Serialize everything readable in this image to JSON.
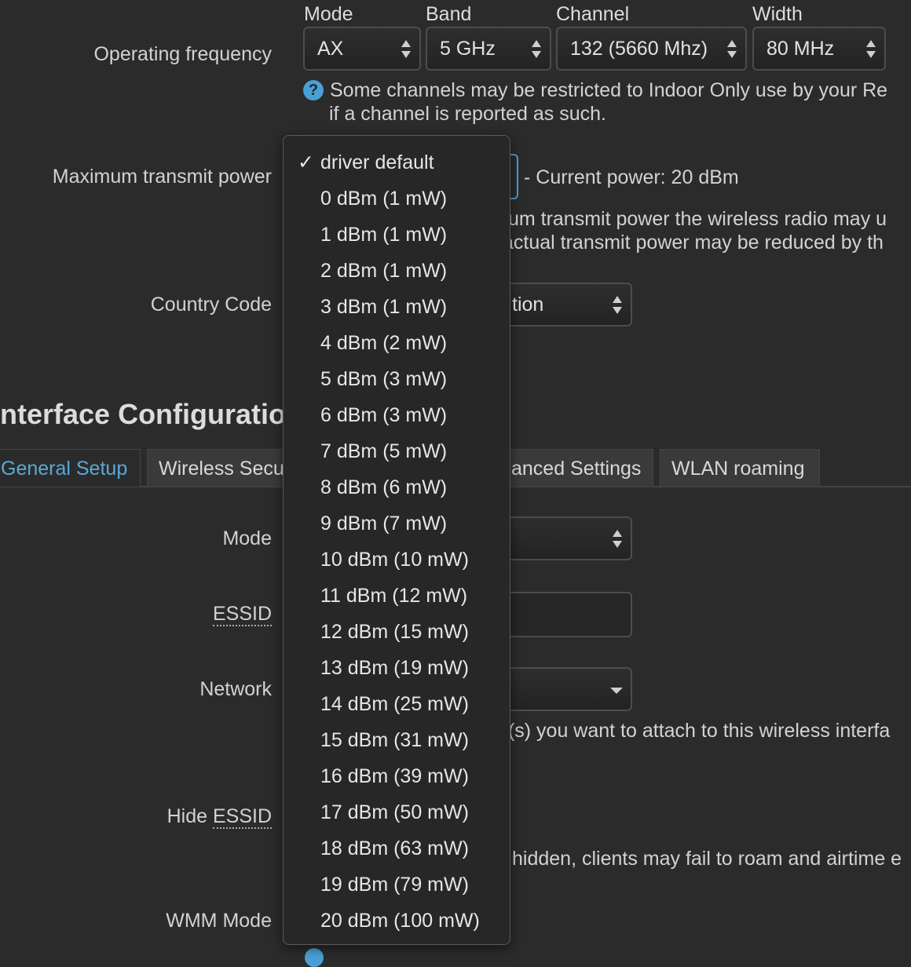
{
  "frequency": {
    "label": "Operating frequency",
    "headers": {
      "mode": "Mode",
      "band": "Band",
      "channel": "Channel",
      "width": "Width"
    },
    "mode_value": "AX",
    "band_value": "5 GHz",
    "channel_value": "132 (5660 Mhz)",
    "width_value": "80 MHz",
    "help_line1": "Some channels may be restricted to Indoor Only use by your Re",
    "help_line2": "if a channel is reported as such."
  },
  "txpower": {
    "label": "Maximum transmit power",
    "current": "- Current power: 20 dBm",
    "help_line1": "ıum transmit power the wireless radio may u",
    "help_line2": "actual transmit power may be reduced by th"
  },
  "country": {
    "label": "Country Code",
    "value_fragment": "tion"
  },
  "interface": {
    "heading": "nterface Configuratio",
    "tabs": {
      "general": "General Setup",
      "security": "Wireless Secu",
      "advanced": "anced Settings",
      "roaming": "WLAN roaming"
    }
  },
  "general": {
    "mode_label": "Mode",
    "essid_label": "ESSID",
    "network_label": "Network",
    "network_help": "t(s) you want to attach to this wireless interfa",
    "hide_essid_label_prefix": "Hide ",
    "hide_essid_label_abbr": "ESSID",
    "hide_help": "hidden, clients may fail to roam and airtime e",
    "wmm_label": "WMM Mode"
  },
  "dropdown": {
    "selected_index": 0,
    "options": [
      "driver default",
      "0 dBm (1 mW)",
      "1 dBm (1 mW)",
      "2 dBm (1 mW)",
      "3 dBm (1 mW)",
      "4 dBm (2 mW)",
      "5 dBm (3 mW)",
      "6 dBm (3 mW)",
      "7 dBm (5 mW)",
      "8 dBm (6 mW)",
      "9 dBm (7 mW)",
      "10 dBm (10 mW)",
      "11 dBm (12 mW)",
      "12 dBm (15 mW)",
      "13 dBm (19 mW)",
      "14 dBm (25 mW)",
      "15 dBm (31 mW)",
      "16 dBm (39 mW)",
      "17 dBm (50 mW)",
      "18 dBm (63 mW)",
      "19 dBm (79 mW)",
      "20 dBm (100 mW)"
    ]
  },
  "colors": {
    "accent": "#5aa9d8",
    "help_icon": "#4a9fd6",
    "background": "#2b2b2b"
  }
}
